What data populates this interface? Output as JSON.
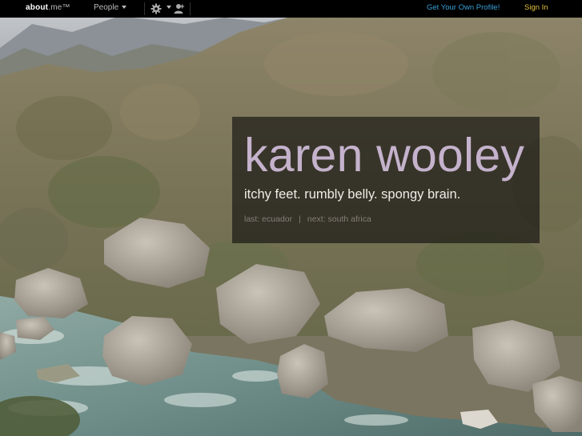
{
  "topbar": {
    "logo_text": "about",
    "logo_suffix": ".me™",
    "people_label": "People",
    "settings_icon": "gear-icon",
    "add_user_icon": "add-user-icon",
    "get_profile_label": "Get Your Own Profile!",
    "sign_in_label": "Sign In"
  },
  "profile": {
    "name": "karen wooley",
    "headline": "itchy feet. rumbly belly. spongy brain.",
    "last_trip": "last: ecuador",
    "divider": "|",
    "next_trip": "next: south africa"
  },
  "colors": {
    "topbar_bg": "#000000",
    "name_color": "#c5b2cc",
    "link_blue": "#3a9fd6",
    "sign_in_yellow": "#e3c13b",
    "card_bg": "rgba(20,18,16,0.66)"
  }
}
